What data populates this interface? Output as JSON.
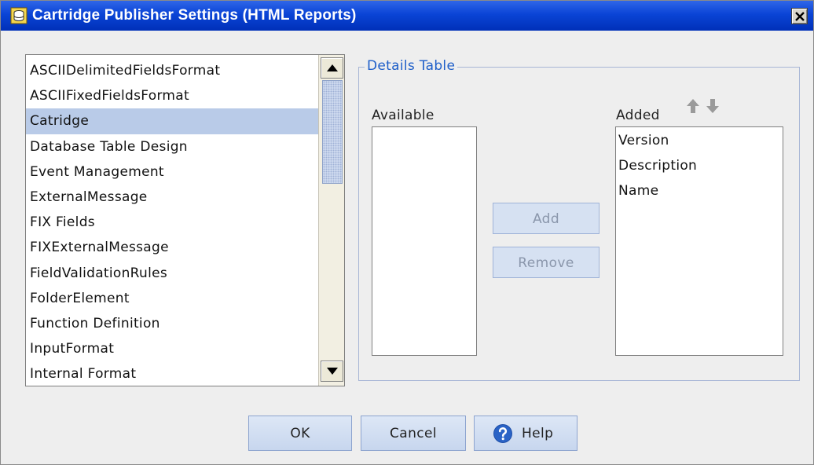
{
  "window": {
    "title": "Cartridge Publisher Settings (HTML Reports)",
    "icon": "cartridge-icon",
    "close_icon": "close-icon"
  },
  "format_list": {
    "items": [
      "ASCIIDelimitedFieldsFormat",
      "ASCIIFixedFieldsFormat",
      "Catridge",
      "Database Table Design",
      "Event Management",
      "ExternalMessage",
      "FIX Fields",
      "FIXExternalMessage",
      "FieldValidationRules",
      "FolderElement",
      "Function Definition",
      "InputFormat",
      "Internal Format"
    ],
    "selected": "Catridge"
  },
  "details_table": {
    "legend": "Details Table",
    "available_label": "Available",
    "added_label": "Added",
    "available_items": [],
    "added_items": [
      "Version",
      "Description",
      "Name"
    ],
    "move_up_icon": "arrow-up-icon",
    "move_down_icon": "arrow-down-icon",
    "add_label": "Add",
    "remove_label": "Remove"
  },
  "footer": {
    "ok_label": "OK",
    "cancel_label": "Cancel",
    "help_label": "Help",
    "help_icon": "help-icon"
  },
  "colors": {
    "titlebar": "#0a44d6",
    "selection": "#b9cbe8",
    "legend_text": "#1f5fc9",
    "button_face": "#cfdcf0"
  }
}
